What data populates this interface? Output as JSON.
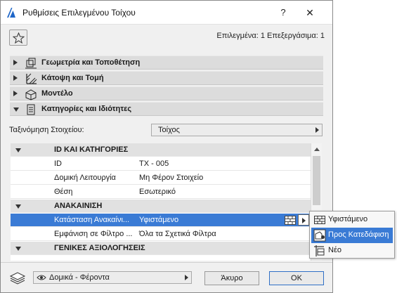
{
  "window": {
    "title": "Ρυθμίσεις Επιλεγμένου Τοίχου",
    "help_label": "?",
    "close_label": "✕"
  },
  "header": {
    "favorites_icon": "star-icon",
    "selection_info": "Επιλεγμένα: 1 Επεξεργάσιμα: 1"
  },
  "panels": [
    {
      "label": "Γεωμετρία και Τοποθέτηση",
      "icon": "geometry-icon",
      "expanded": false
    },
    {
      "label": "Κάτοψη και Τομή",
      "icon": "floorplan-section-icon",
      "expanded": false
    },
    {
      "label": "Μοντέλο",
      "icon": "model-box-icon",
      "expanded": false
    },
    {
      "label": "Κατηγορίες και Ιδιότητες",
      "icon": "document-icon",
      "expanded": true
    }
  ],
  "classification": {
    "label": "Ταξινόμηση Στοιχείου:",
    "value": "Τοίχος"
  },
  "properties": {
    "rows": [
      {
        "type": "group",
        "name": "ID ΚΑΙ ΚΑΤΗΓΟΡΙΕΣ"
      },
      {
        "type": "prop",
        "name": "ID",
        "value": "ΤΧ - 005"
      },
      {
        "type": "prop",
        "name": "Δομική Λειτουργία",
        "value": "Μη Φέρον Στοιχείο"
      },
      {
        "type": "prop",
        "name": "Θέση",
        "value": "Εσωτερικό"
      },
      {
        "type": "group",
        "name": "ΑΝΑΚΑΙΝΙΣΗ"
      },
      {
        "type": "prop",
        "name": "Κατάσταση Ανακαίνι...",
        "value": "Υφιστάμενο",
        "selected": true
      },
      {
        "type": "prop",
        "name": "Εμφάνιση σε Φίλτρο ...",
        "value": "Όλα τα Σχετικά Φίλτρα"
      },
      {
        "type": "group",
        "name": "ΓΕΝΙΚΕΣ ΑΞΙΟΛΟΓΗΣΕΙΣ"
      }
    ]
  },
  "renovation_popup": {
    "items": [
      {
        "label": "Υφιστάμενο",
        "icon": "existing-wall-icon",
        "highlighted": false
      },
      {
        "label": "Προς Κατεδάφιση",
        "icon": "demolish-icon",
        "highlighted": true
      },
      {
        "label": "Νέο",
        "icon": "new-element-icon",
        "highlighted": false
      }
    ]
  },
  "footer": {
    "layer_icon": "layers-icon",
    "view_icon": "eye-icon",
    "view_value": "Δομικά - Φέροντα",
    "cancel_label": "Άκυρο",
    "ok_label": "ΟΚ"
  },
  "colors": {
    "selection": "#3a7bd5",
    "dialog_bg": "#f0f0f0",
    "panel_bg": "#dcdcdc"
  }
}
